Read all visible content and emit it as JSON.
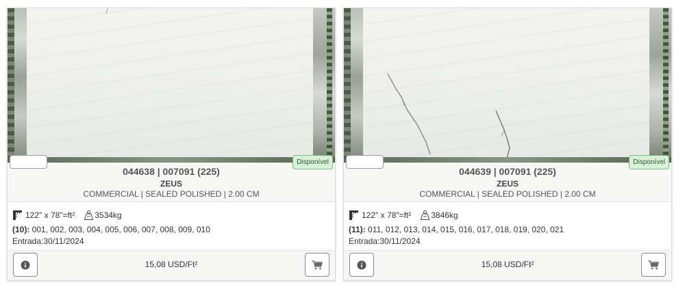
{
  "cards": [
    {
      "status": "Disponível",
      "title": "044638 | 007091 (225)",
      "material": "ZEUS",
      "finish": "COMMERCIAL | SEALED POLISHED | 2.00 CM",
      "dimensions": "122\" x 78\"=ft²",
      "weight": "3534kg",
      "pieces_count": "(10):",
      "pieces_list": " 001, 002, 003, 004, 005, 006, 007, 008, 009, 010",
      "entry": "Entrada:30/11/2024",
      "price": "15,08 USD/Ft²"
    },
    {
      "status": "Disponível",
      "title": "044639 | 007091 (225)",
      "material": "ZEUS",
      "finish": "COMMERCIAL | SEALED POLISHED | 2.00 CM",
      "dimensions": "122\" x 78\"=ft²",
      "weight": "3846kg",
      "pieces_count": "(11):",
      "pieces_list": " 011, 012, 013, 014, 015, 016, 017, 018, 019, 020, 021",
      "entry": "Entrada:30/11/2024",
      "price": "15,08 USD/Ft²"
    }
  ],
  "icons": {
    "dimensions": "ruler-icon",
    "weight": "weight-scale-icon",
    "info": "info-icon",
    "cart": "cart-icon"
  },
  "colors": {
    "status_bg": "#d8f0d8",
    "status_border": "#7cbf7c",
    "card_bg": "#f6f6f4"
  }
}
